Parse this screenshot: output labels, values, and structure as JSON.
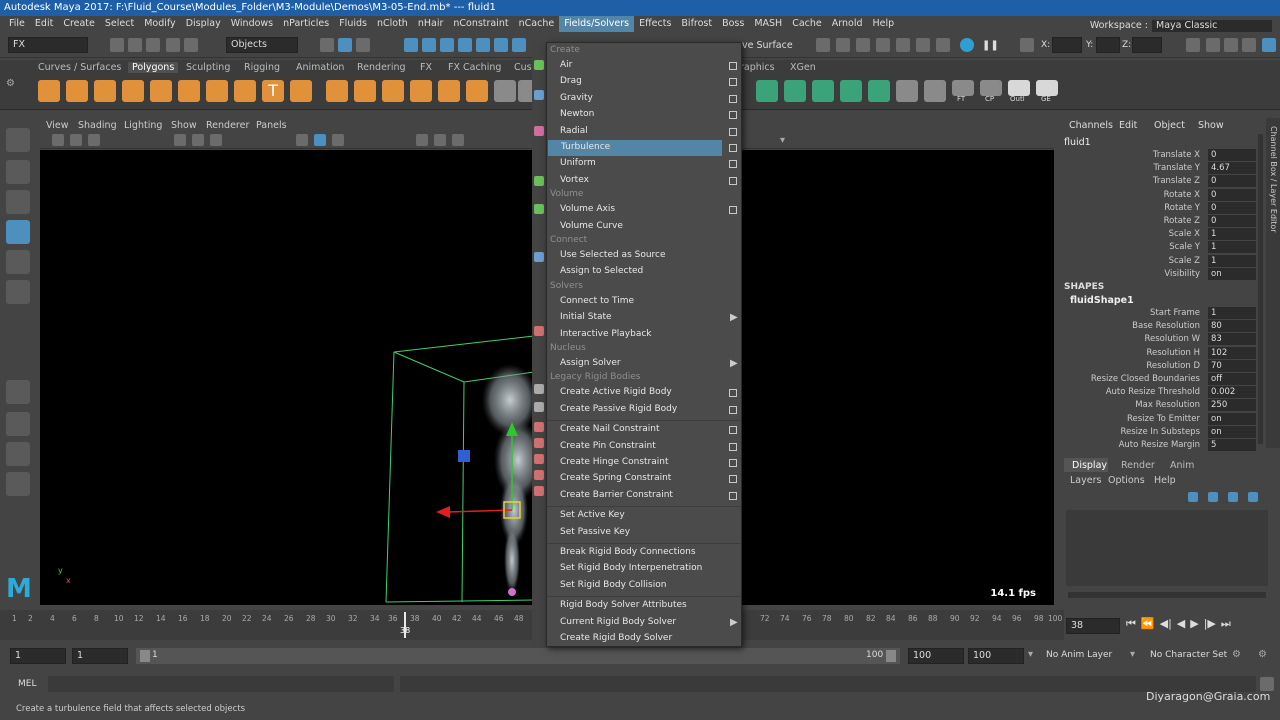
{
  "titlebar": {
    "text": "Autodesk Maya 2017: F:\\Fluid_Course\\Modules_Folder\\M3-Module\\Demos\\M3-05-End.mb*  ---  fluid1"
  },
  "menubar": {
    "items": [
      "File",
      "Edit",
      "Create",
      "Select",
      "Modify",
      "Display",
      "Windows",
      "nParticles",
      "Fluids",
      "nCloth",
      "nHair",
      "nConstraint",
      "nCache",
      "Fields/Solvers",
      "Effects",
      "Bifrost",
      "Boss",
      "MASH",
      "Cache",
      "Arnold",
      "Help"
    ],
    "active_index": 13,
    "workspace_label": "Workspace :",
    "workspace_value": "Maya Classic"
  },
  "statusline": {
    "menuset": "FX",
    "select_mode": "Objects",
    "live_surface": "ve Surface",
    "x_label": "X:",
    "y_label": "Y:",
    "z_label": "Z:"
  },
  "shelf": {
    "tabs": [
      "Curves / Surfaces",
      "Polygons",
      "Sculpting",
      "Rigging",
      "Animation",
      "Rendering",
      "FX",
      "FX Caching",
      "Cust",
      "raphics",
      "XGen"
    ],
    "active_tab": 1,
    "icon_labels": [
      "FT",
      "CP",
      "Outl",
      "GE"
    ]
  },
  "viewport": {
    "menu": [
      "View",
      "Shading",
      "Lighting",
      "Show",
      "Renderer",
      "Panels"
    ],
    "fps": "14.1 fps",
    "axis_y": "y",
    "axis_x": "x"
  },
  "channelbox": {
    "tabs": [
      "Channels",
      "Edit",
      "Object",
      "Show"
    ],
    "object_name": "fluid1",
    "transform": [
      {
        "label": "Translate X",
        "value": "0"
      },
      {
        "label": "Translate Y",
        "value": "4.67"
      },
      {
        "label": "Translate Z",
        "value": "0"
      },
      {
        "label": "Rotate X",
        "value": "0"
      },
      {
        "label": "Rotate Y",
        "value": "0"
      },
      {
        "label": "Rotate Z",
        "value": "0"
      },
      {
        "label": "Scale X",
        "value": "1"
      },
      {
        "label": "Scale Y",
        "value": "1"
      },
      {
        "label": "Scale Z",
        "value": "1"
      },
      {
        "label": "Visibility",
        "value": "on"
      }
    ],
    "shapes_header": "SHAPES",
    "shape_name": "fluidShape1",
    "shape_attrs": [
      {
        "label": "Start Frame",
        "value": "1"
      },
      {
        "label": "Base Resolution",
        "value": "80"
      },
      {
        "label": "Resolution W",
        "value": "83"
      },
      {
        "label": "Resolution H",
        "value": "102"
      },
      {
        "label": "Resolution D",
        "value": "70"
      },
      {
        "label": "Resize Closed Boundaries",
        "value": "off"
      },
      {
        "label": "Auto Resize Threshold",
        "value": "0.002"
      },
      {
        "label": "Max Resolution",
        "value": "250"
      },
      {
        "label": "Resize To Emitter",
        "value": "on"
      },
      {
        "label": "Resize In Substeps",
        "value": "on"
      },
      {
        "label": "Auto Resize Margin",
        "value": "5"
      }
    ],
    "side_label": "Channel Box / Layer Editor"
  },
  "layerpanel": {
    "tabs": [
      "Display",
      "Render",
      "Anim"
    ],
    "menu": [
      "Layers",
      "Options",
      "Help"
    ]
  },
  "timeline": {
    "ticks": [
      "1",
      "2",
      "4",
      "6",
      "8",
      "10",
      "12",
      "14",
      "16",
      "18",
      "20",
      "22",
      "24",
      "26",
      "28",
      "30",
      "32",
      "34",
      "36",
      "38",
      "40",
      "42",
      "44",
      "46",
      "48",
      "",
      "72",
      "74",
      "76",
      "78",
      "80",
      "82",
      "84",
      "86",
      "88",
      "90",
      "92",
      "94",
      "96",
      "98",
      "100"
    ],
    "current_frame": "38",
    "current_field": "38"
  },
  "rangebar": {
    "start": "1",
    "playback_start": "1",
    "slider_start": "1",
    "slider_end": "100",
    "playback_end": "100",
    "end": "100",
    "anim_layer": "No Anim Layer",
    "character_set": "No Character Set"
  },
  "cmdline": {
    "label": "MEL"
  },
  "helpline": {
    "text": "Create a turbulence field that affects selected objects"
  },
  "watermark": "Diyaragon@Graia.com",
  "menu": {
    "sections": [
      {
        "title": "Create",
        "items": [
          {
            "label": "Air",
            "box": true
          },
          {
            "label": "Drag",
            "box": true
          },
          {
            "label": "Gravity",
            "box": true
          },
          {
            "label": "Newton",
            "box": true
          },
          {
            "label": "Radial",
            "box": true
          },
          {
            "label": "Turbulence",
            "box": true,
            "hl": true
          },
          {
            "label": "Uniform",
            "box": true
          },
          {
            "label": "Vortex",
            "box": true
          }
        ]
      },
      {
        "title": "Volume",
        "items": [
          {
            "label": "Volume Axis",
            "box": true
          },
          {
            "label": "Volume Curve"
          }
        ]
      },
      {
        "title": "Connect",
        "items": [
          {
            "label": "Use Selected as Source"
          },
          {
            "label": "Assign to Selected"
          }
        ]
      },
      {
        "title": "Solvers",
        "items": [
          {
            "label": "Connect to Time"
          },
          {
            "label": "Initial State",
            "arrow": true
          },
          {
            "label": "Interactive Playback"
          }
        ]
      },
      {
        "title": "Nucleus",
        "items": [
          {
            "label": "Assign Solver",
            "arrow": true
          }
        ]
      },
      {
        "title": "Legacy Rigid Bodies",
        "items": [
          {
            "label": "Create Active Rigid Body",
            "box": true
          },
          {
            "label": "Create Passive Rigid Body",
            "box": true
          },
          {
            "sep": true
          },
          {
            "label": "Create Nail Constraint",
            "box": true
          },
          {
            "label": "Create Pin Constraint",
            "box": true
          },
          {
            "label": "Create Hinge Constraint",
            "box": true
          },
          {
            "label": "Create Spring Constraint",
            "box": true
          },
          {
            "label": "Create Barrier Constraint",
            "box": true
          },
          {
            "sep": true
          },
          {
            "label": "Set Active Key"
          },
          {
            "label": "Set Passive Key"
          },
          {
            "sep": true
          },
          {
            "label": "Break Rigid Body Connections"
          },
          {
            "label": "Set Rigid Body Interpenetration"
          },
          {
            "label": "Set Rigid Body Collision"
          },
          {
            "sep": true
          },
          {
            "label": "Rigid Body Solver Attributes"
          },
          {
            "label": "Current Rigid Body Solver",
            "arrow": true
          },
          {
            "label": "Create Rigid Body Solver"
          }
        ]
      }
    ]
  }
}
